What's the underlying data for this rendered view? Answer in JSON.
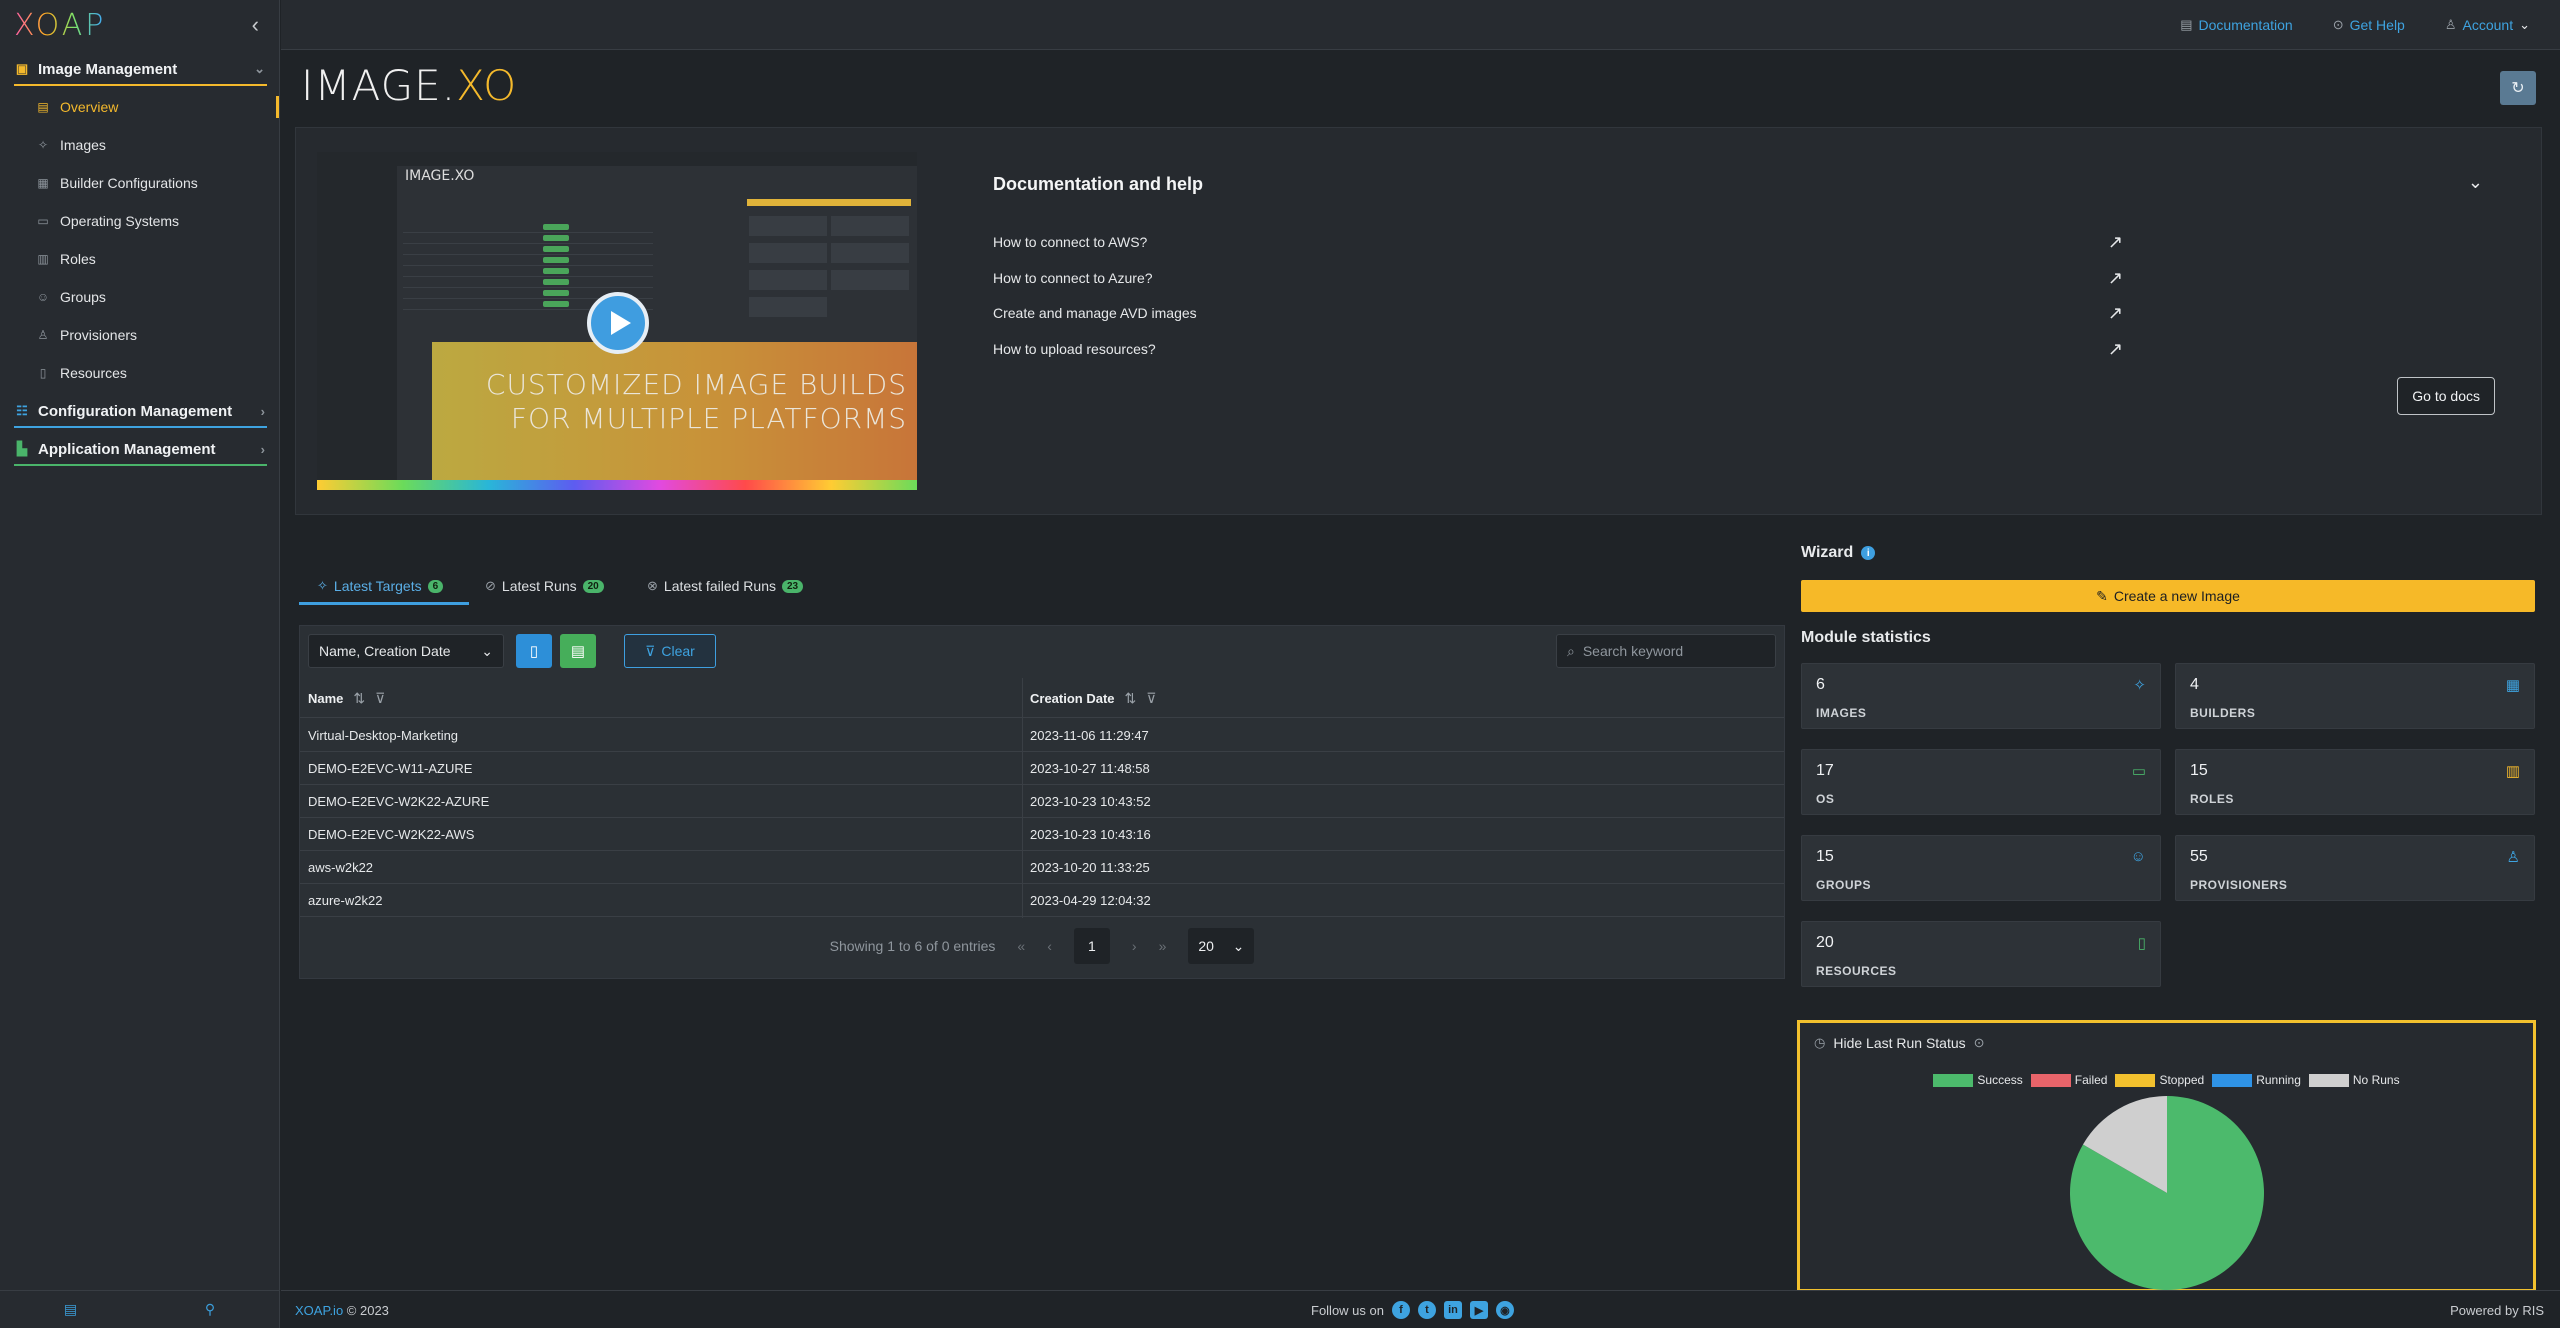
{
  "brand": {
    "logo": "XOAP",
    "collapse_icon": "chevron-left-icon"
  },
  "sidebar": {
    "groups": [
      {
        "label": "Image Management",
        "icon": "image-stack-icon",
        "color": "#f4b92c",
        "expanded": true
      },
      {
        "label": "Configuration Management",
        "icon": "config-icon",
        "color": "#3ea3e0",
        "expanded": false
      },
      {
        "label": "Application Management",
        "icon": "apps-icon",
        "color": "#4ab46a",
        "expanded": false
      }
    ],
    "items": [
      {
        "label": "Overview",
        "icon": "overview-icon",
        "active": true
      },
      {
        "label": "Images",
        "icon": "images-icon"
      },
      {
        "label": "Builder Configurations",
        "icon": "builder-icon"
      },
      {
        "label": "Operating Systems",
        "icon": "os-icon"
      },
      {
        "label": "Roles",
        "icon": "roles-icon"
      },
      {
        "label": "Groups",
        "icon": "groups-icon"
      },
      {
        "label": "Provisioners",
        "icon": "provisioners-icon"
      },
      {
        "label": "Resources",
        "icon": "resources-icon"
      }
    ]
  },
  "topbar": {
    "documentation": "Documentation",
    "get_help": "Get Help",
    "account": "Account"
  },
  "product": {
    "logo_main": "IMAGE.",
    "logo_hl": "XO"
  },
  "video": {
    "mini_logo": "IMAGE.XO",
    "banner_line1": "CUSTOMIZED IMAGE BUILDS",
    "banner_line2": "FOR MULTIPLE PLATFORMS"
  },
  "docs": {
    "title": "Documentation and help",
    "links": [
      "How to connect to AWS?",
      "How to connect to Azure?",
      "Create and manage AVD images",
      "How to upload resources?"
    ],
    "button": "Go to docs"
  },
  "tabs": [
    {
      "label": "Latest Targets",
      "badge": "6",
      "active": true
    },
    {
      "label": "Latest Runs",
      "badge": "20",
      "active": false
    },
    {
      "label": "Latest failed Runs",
      "badge": "23",
      "active": false
    }
  ],
  "table": {
    "columns_select": "Name, Creation Date",
    "clear_label": "Clear",
    "search_placeholder": "Search keyword",
    "headers": [
      "Name",
      "Creation Date"
    ],
    "rows": [
      [
        "Virtual-Desktop-Marketing",
        "2023-11-06 11:29:47"
      ],
      [
        "DEMO-E2EVC-W11-AZURE",
        "2023-10-27 11:48:58"
      ],
      [
        "DEMO-E2EVC-W2K22-AZURE",
        "2023-10-23 10:43:52"
      ],
      [
        "DEMO-E2EVC-W2K22-AWS",
        "2023-10-23 10:43:16"
      ],
      [
        "aws-w2k22",
        "2023-10-20 11:33:25"
      ],
      [
        "azure-w2k22",
        "2023-04-29 12:04:32"
      ]
    ],
    "showing": "Showing 1 to 6 of 0 entries",
    "page": "1",
    "page_size": "20"
  },
  "wizard": {
    "title": "Wizard",
    "create_button": "Create a new Image",
    "stats_title": "Module statistics",
    "stats": [
      {
        "value": "6",
        "label": "IMAGES",
        "icon": "crosshair-icon",
        "color": "#3ea3e0"
      },
      {
        "value": "4",
        "label": "BUILDERS",
        "icon": "grid-icon",
        "color": "#3ea3e0"
      },
      {
        "value": "17",
        "label": "OS",
        "icon": "monitor-icon",
        "color": "#4ab46a"
      },
      {
        "value": "15",
        "label": "ROLES",
        "icon": "map-icon",
        "color": "#f4b92c"
      },
      {
        "value": "15",
        "label": "GROUPS",
        "icon": "users-icon",
        "color": "#3ea3e0"
      },
      {
        "value": "55",
        "label": "PROVISIONERS",
        "icon": "user-icon",
        "color": "#3ea3e0"
      },
      {
        "value": "20",
        "label": "RESOURCES",
        "icon": "file-icon",
        "color": "#4ab46a"
      }
    ]
  },
  "run_status": {
    "title": "Hide Last Run Status",
    "legend": [
      {
        "name": "Success",
        "color": "#4cba6c"
      },
      {
        "name": "Failed",
        "color": "#e8646a"
      },
      {
        "name": "Stopped",
        "color": "#f2c12e"
      },
      {
        "name": "Running",
        "color": "#2f93e6"
      },
      {
        "name": "No Runs",
        "color": "#cfcfcf"
      }
    ]
  },
  "chart_data": {
    "type": "pie",
    "categories": [
      "Success",
      "Failed",
      "Stopped",
      "Running",
      "No Runs"
    ],
    "values": [
      5,
      0,
      0,
      0,
      1
    ]
  },
  "footer": {
    "link": "XOAP.io",
    "copyright": " © 2023",
    "follow": "Follow us on",
    "powered": "Powered by RIS"
  }
}
